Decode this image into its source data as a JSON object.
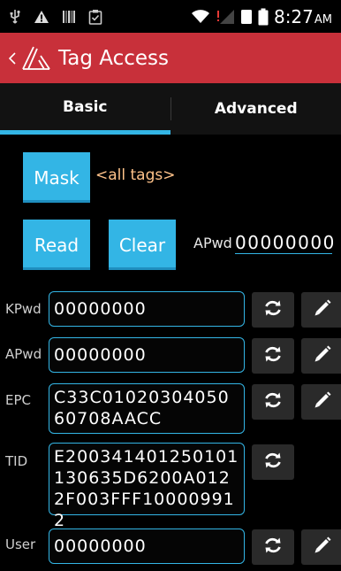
{
  "status_bar": {
    "time": "8:27",
    "ampm": "AM",
    "icons": [
      "usb-icon",
      "warning-icon",
      "barcode-icon",
      "clipboard-icon",
      "wifi-icon",
      "signal-icon",
      "sim-icon",
      "battery-icon"
    ]
  },
  "action_bar": {
    "title": "Tag Access"
  },
  "tabs": [
    {
      "label": "Basic",
      "active": true
    },
    {
      "label": "Advanced",
      "active": false
    }
  ],
  "mask": {
    "button_label": "Mask",
    "value": "<all tags>"
  },
  "read_button": "Read",
  "clear_button": "Clear",
  "apwd_top": {
    "label": "APwd",
    "value": "00000000"
  },
  "rows": [
    {
      "label": "KPwd",
      "value": "00000000"
    },
    {
      "label": "APwd",
      "value": "00000000"
    },
    {
      "label": "EPC",
      "value": "C33C0102030405060708AACC"
    },
    {
      "label": "TID",
      "value": "E200341401250101130635D6200A0122F003FFF100009912"
    },
    {
      "label": "User",
      "value": "00000000"
    }
  ],
  "colors": {
    "accent": "#33b5e5",
    "action_bar": "#c8303a",
    "mask_value": "#ffc38a",
    "background": "#000000"
  }
}
